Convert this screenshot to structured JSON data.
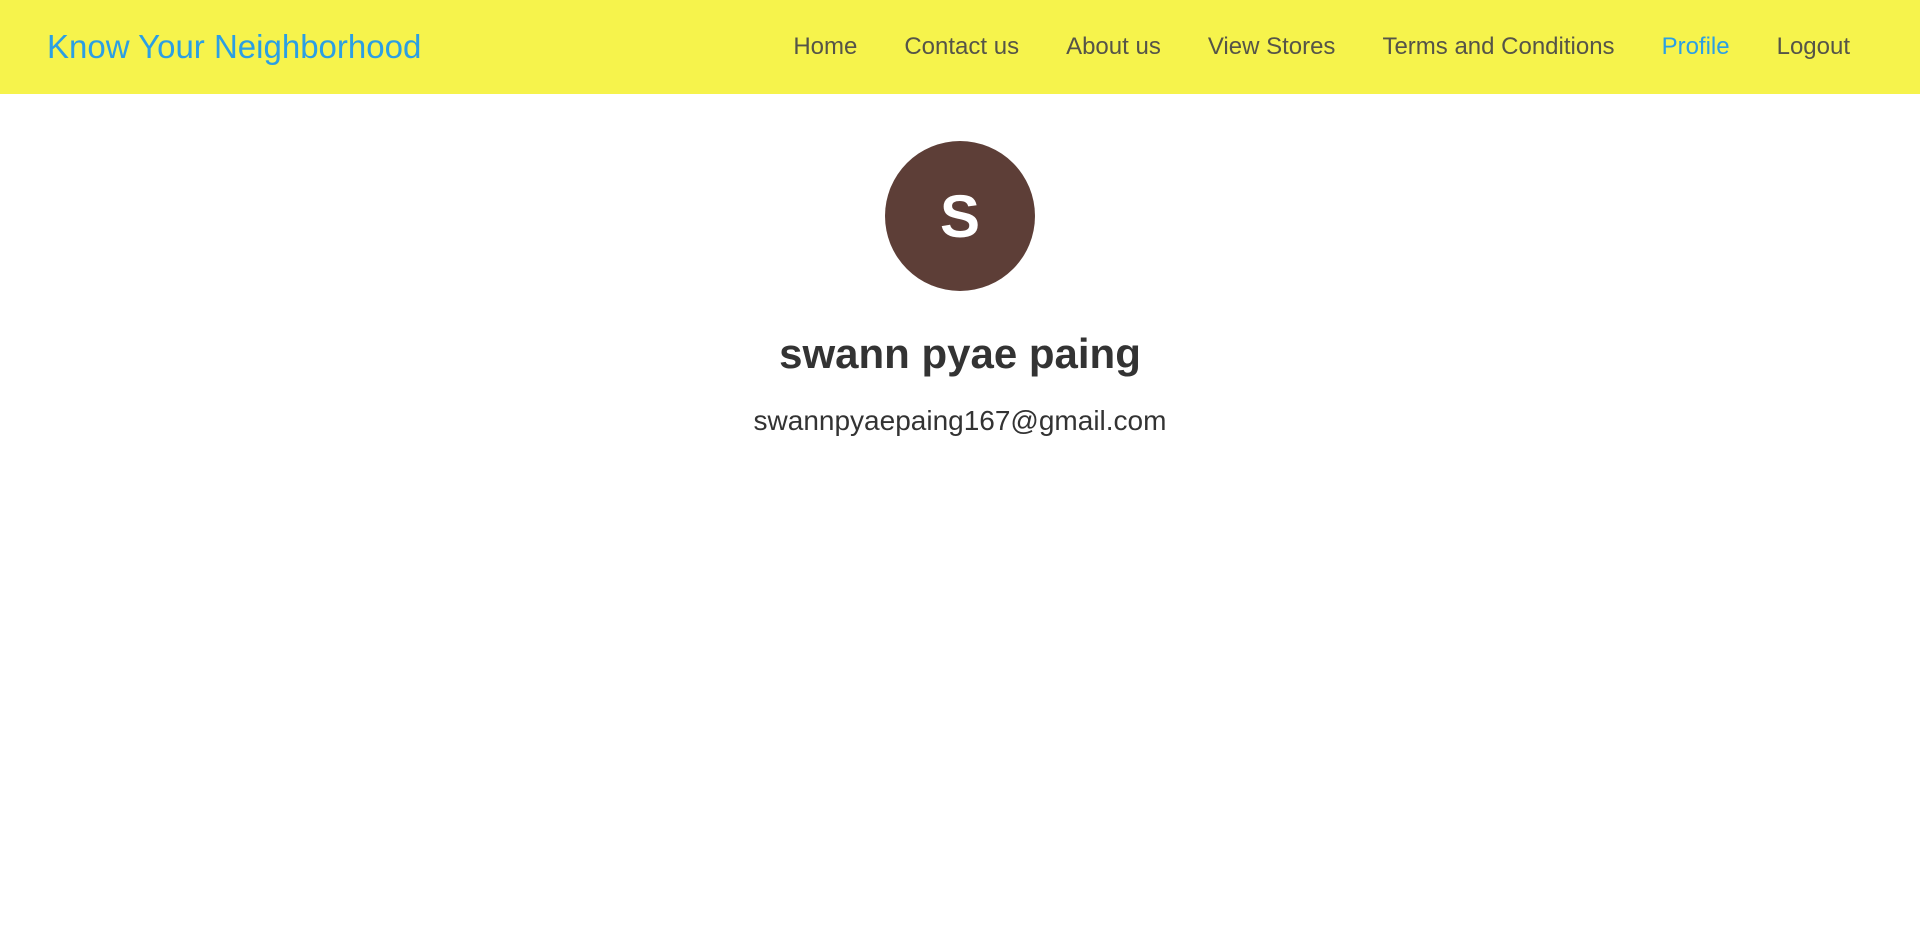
{
  "header": {
    "brand": "Know Your Neighborhood",
    "nav": [
      {
        "label": "Home",
        "active": false
      },
      {
        "label": "Contact us",
        "active": false
      },
      {
        "label": "About us",
        "active": false
      },
      {
        "label": "View Stores",
        "active": false
      },
      {
        "label": "Terms and Conditions",
        "active": false
      },
      {
        "label": "Profile",
        "active": true
      },
      {
        "label": "Logout",
        "active": false
      }
    ],
    "colors": {
      "background": "#f6f34c",
      "brand": "#2b9fe4",
      "link": "#555448",
      "active_link": "#2b9fe4"
    }
  },
  "profile": {
    "avatar_initial": "S",
    "avatar_color": "#5d3e37",
    "name": "swann pyae paing",
    "email": "swannpyaepaing167@gmail.com"
  }
}
